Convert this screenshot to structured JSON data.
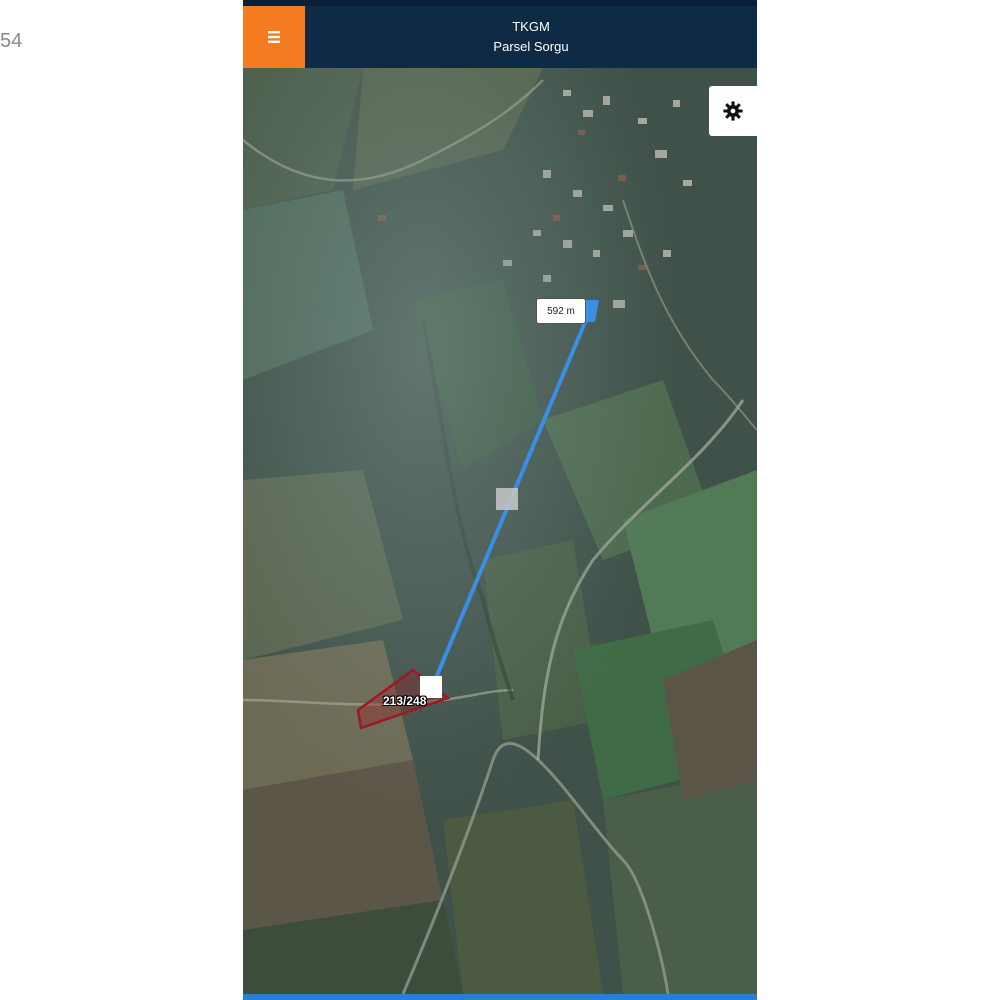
{
  "edge_text": "54",
  "app": {
    "title": "TKGM",
    "subtitle": "Parsel Sorgu"
  },
  "icons": {
    "menu": "hamburger-menu-icon",
    "settings": "gear-icon"
  },
  "map": {
    "type": "satellite",
    "distance_label": "592 m",
    "parcel_label": "213/248"
  },
  "colors": {
    "header": "#0f2a44",
    "menu_button": "#f47b20",
    "measure_line": "#3a8ee6",
    "parcel_outline": "#9b1b22",
    "bottom_bar": "#2a7fd4"
  }
}
